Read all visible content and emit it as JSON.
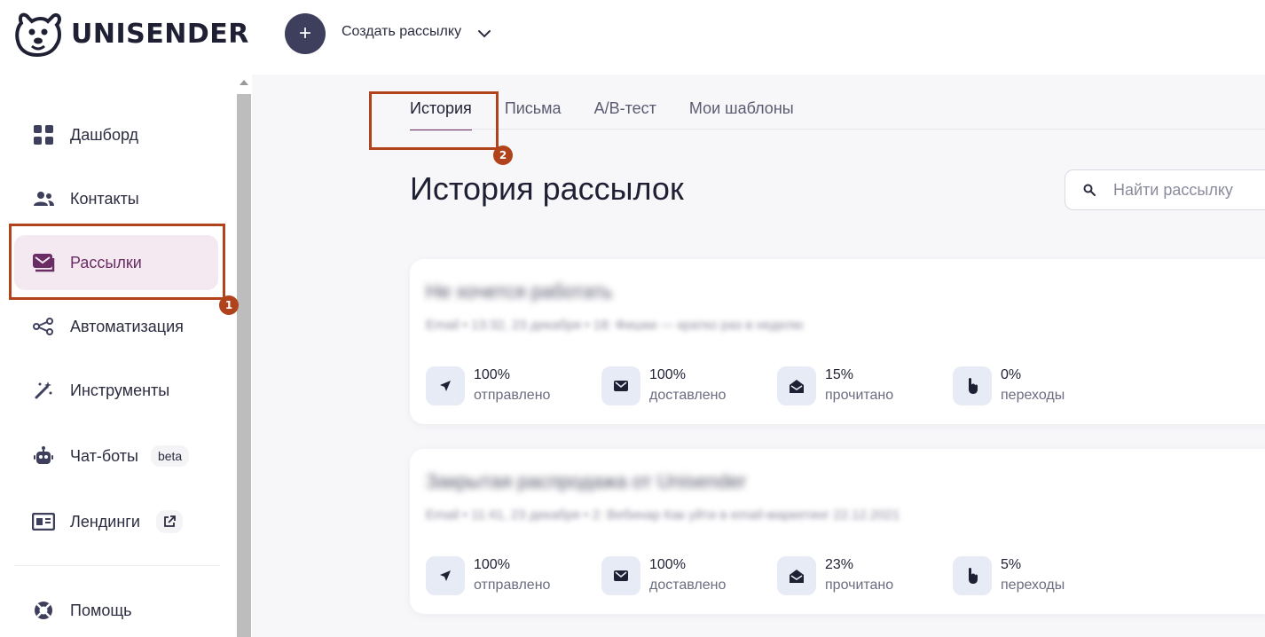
{
  "brand": {
    "name": "UNISENDER"
  },
  "header": {
    "create_icon": "+",
    "create_label": "Создать рассылку"
  },
  "sidebar": {
    "items": [
      {
        "label": "Дашборд",
        "icon": "grid-icon"
      },
      {
        "label": "Контакты",
        "icon": "users-icon"
      },
      {
        "label": "Рассылки",
        "icon": "mail-stack-icon",
        "active": true
      },
      {
        "label": "Автоматизация",
        "icon": "flow-icon"
      },
      {
        "label": "Инструменты",
        "icon": "magic-wand-icon"
      },
      {
        "label": "Чат-боты",
        "icon": "robot-icon",
        "badge": "beta"
      },
      {
        "label": "Лендинги",
        "icon": "landing-icon",
        "badge_icon": "external-link-icon"
      },
      {
        "label": "Помощь",
        "icon": "lifebuoy-icon"
      }
    ]
  },
  "tabs": [
    "История",
    "Письма",
    "A/B-тест",
    "Мои шаблоны"
  ],
  "page": {
    "title": "История рассылок"
  },
  "search": {
    "placeholder": "Найти рассылку"
  },
  "campaigns": [
    {
      "title": "Не хочется работать",
      "meta": "Email • 13:32, 23 декабря • 18: Фишки — кратко раз в неделю",
      "stats": [
        {
          "value": "100%",
          "label": "отправлено"
        },
        {
          "value": "100%",
          "label": "доставлено"
        },
        {
          "value": "15%",
          "label": "прочитано"
        },
        {
          "value": "0%",
          "label": "переходы"
        }
      ]
    },
    {
      "title": "Закрытая распродажа от Unisender",
      "meta": "Email • 11:41, 23 декабря • 2: Вебинар Как уйти в email-маркетинг 22.12.2021",
      "stats": [
        {
          "value": "100%",
          "label": "отправлено"
        },
        {
          "value": "100%",
          "label": "доставлено"
        },
        {
          "value": "23%",
          "label": "прочитано"
        },
        {
          "value": "5%",
          "label": "переходы"
        }
      ]
    }
  ],
  "annotations": [
    "1",
    "2"
  ],
  "colors": {
    "accent": "#6b2c63",
    "active_bg": "#f4e9f1",
    "annotation": "#b0431c",
    "create_button": "#3d3f5c"
  }
}
